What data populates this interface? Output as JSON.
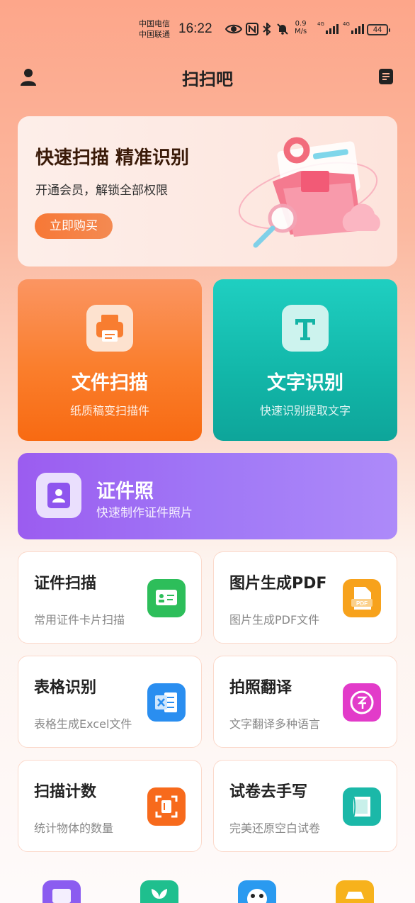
{
  "status_bar": {
    "carrier1": "中国电信",
    "carrier2": "中国联通",
    "time": "16:22",
    "net_speed_value": "0.9",
    "net_speed_unit": "M/s",
    "signal1_tag": "4G",
    "signal2_tag": "4G",
    "battery": "44"
  },
  "header": {
    "title": "扫扫吧"
  },
  "banner": {
    "title": "快速扫描 精准识别",
    "subtitle": "开通会员，解锁全部权限",
    "button": "立即购买"
  },
  "features": {
    "scan": {
      "title": "文件扫描",
      "subtitle": "纸质稿变扫描件",
      "icon": "printer-icon"
    },
    "ocr": {
      "title": "文字识别",
      "subtitle": "快速识别提取文字",
      "icon": "text-t-icon"
    },
    "id_photo": {
      "title": "证件照",
      "subtitle": "快速制作证件照片",
      "icon": "id-photo-icon"
    }
  },
  "tools": [
    {
      "title": "证件扫描",
      "subtitle": "常用证件卡片扫描",
      "icon": "id-card-icon",
      "color": "#2dbe5a"
    },
    {
      "title": "图片生成PDF",
      "subtitle": "图片生成PDF文件",
      "icon": "pdf-icon",
      "color": "#f7a21c"
    },
    {
      "title": "表格识别",
      "subtitle": "表格生成Excel文件",
      "icon": "excel-icon",
      "color": "#2a8ef0"
    },
    {
      "title": "拍照翻译",
      "subtitle": "文字翻译多种语言",
      "icon": "translate-icon",
      "color": "#e23bc9"
    },
    {
      "title": "扫描计数",
      "subtitle": "统计物体的数量",
      "icon": "count-scan-icon",
      "color": "#f76a1c"
    },
    {
      "title": "试卷去手写",
      "subtitle": "完美还原空白试卷",
      "icon": "paper-icon",
      "color": "#1bb8a8"
    }
  ],
  "bottom_row": [
    {
      "icon": "store-icon",
      "color": "#8b5cf0"
    },
    {
      "icon": "plant-icon",
      "color": "#1fbf8e"
    },
    {
      "icon": "panda-icon",
      "color": "#2a9af0"
    },
    {
      "icon": "car-icon",
      "color": "#f7b21c"
    }
  ]
}
